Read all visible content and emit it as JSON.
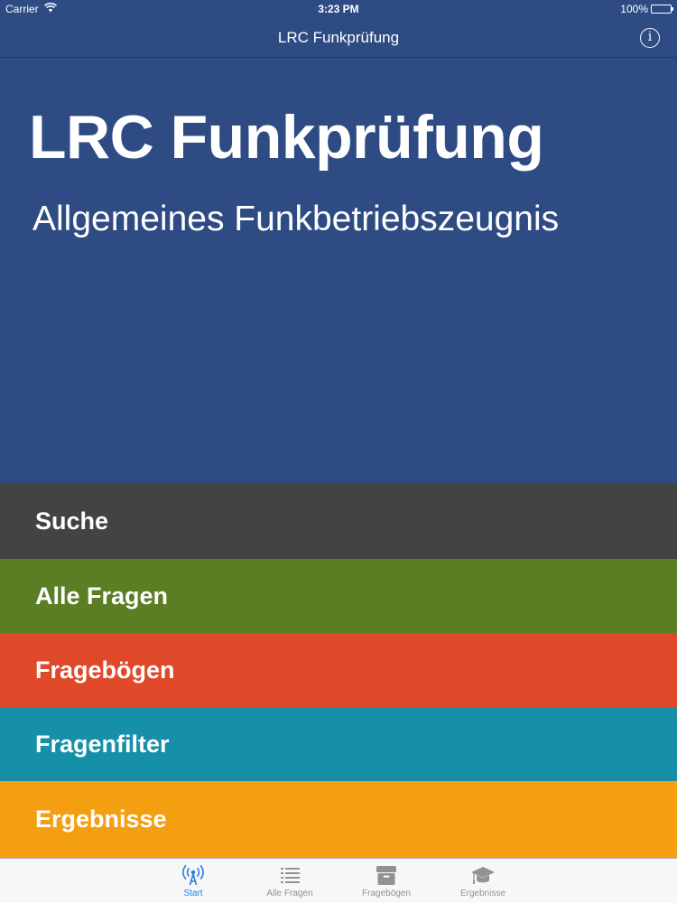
{
  "status_bar": {
    "carrier": "Carrier",
    "time": "3:23 PM",
    "battery": "100%"
  },
  "nav": {
    "title": "LRC Funkprüfung",
    "info_icon": "info-icon"
  },
  "hero": {
    "title": "LRC Funkprüfung",
    "subtitle": "Allgemeines Funkbetriebszeugnis"
  },
  "menu": [
    {
      "label": "Suche",
      "color": "#434343"
    },
    {
      "label": "Alle Fragen",
      "color": "#5b7e25"
    },
    {
      "label": "Fragebögen",
      "color": "#e0482a"
    },
    {
      "label": "Fragenfilter",
      "color": "#168fa9"
    },
    {
      "label": "Ergebnisse",
      "color": "#f49e12"
    }
  ],
  "tabs": [
    {
      "label": "Start",
      "icon": "antenna-icon",
      "active": true
    },
    {
      "label": "Alle Fragen",
      "icon": "list-icon",
      "active": false
    },
    {
      "label": "Fragebögen",
      "icon": "archive-box-icon",
      "active": false
    },
    {
      "label": "Ergebnisse",
      "icon": "graduation-cap-icon",
      "active": false
    }
  ],
  "colors": {
    "background": "#2e4c83",
    "tab_active": "#2c7de0",
    "tab_inactive": "#929292"
  }
}
